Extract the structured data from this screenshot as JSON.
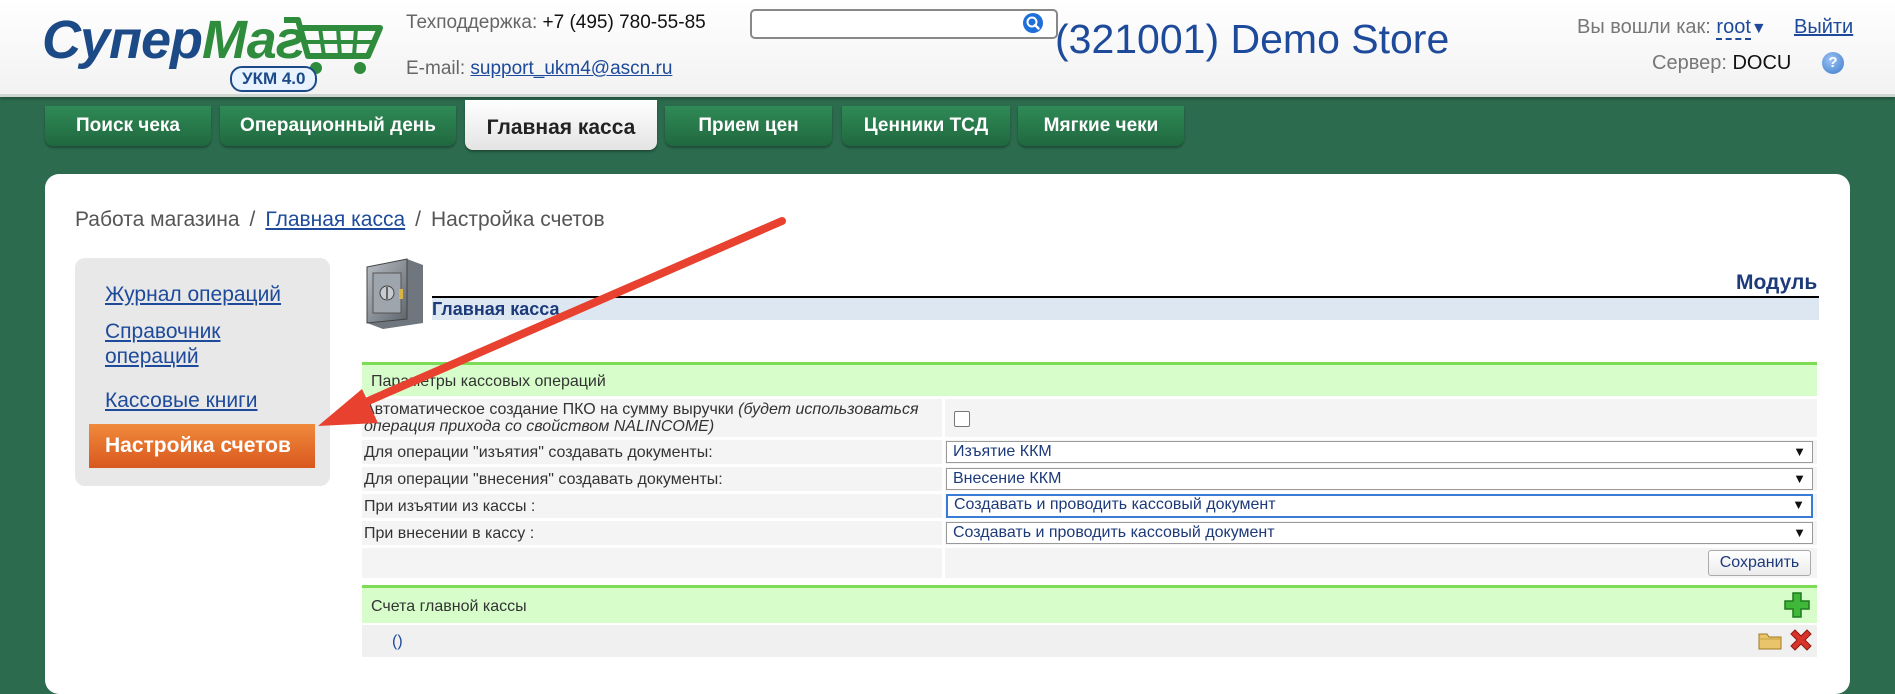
{
  "header": {
    "logo_line1": "Супер",
    "logo_line2": "Маг",
    "logo_badge": "УКМ 4.0",
    "support_label": "Техподдержка:",
    "support_phone": "+7 (495) 780-55-85",
    "email_label": "E-mail:",
    "email_value": "support_ukm4@ascn.ru",
    "search_value": "",
    "store_title": "(321001) Demo Store",
    "logged_in_label": "Вы вошли как:",
    "user": "root",
    "logout": "Выйти",
    "server_label": "Сервер:",
    "server_value": "DOCU",
    "help": "?"
  },
  "tabs": [
    {
      "label": "Поиск чека",
      "active": false
    },
    {
      "label": "Операционный день",
      "active": false
    },
    {
      "label": "Главная касса",
      "active": true
    },
    {
      "label": "Прием цен",
      "active": false
    },
    {
      "label": "Ценники ТСД",
      "active": false
    },
    {
      "label": "Мягкие чеки",
      "active": false
    }
  ],
  "breadcrumb": {
    "root": "Работа магазина",
    "sep": "/",
    "parent": "Главная касса",
    "current": "Настройка счетов"
  },
  "sidebar": {
    "items": [
      {
        "label": "Журнал операций"
      },
      {
        "label": "Справочник"
      },
      {
        "label": "операций"
      },
      {
        "label": "Кассовые книги"
      },
      {
        "label": "Настройка счетов"
      }
    ]
  },
  "module": {
    "label": "Модуль",
    "name": "Главная касса"
  },
  "params": {
    "title": "Параметры кассовых операций",
    "auto_pko_label": "Автоматическое создание ПКО на сумму выручки",
    "auto_pko_note_line1": "(будет использоваться",
    "auto_pko_note_line2": "операция прихода со свойством NALINCOME)",
    "auto_pko_checked": false,
    "withdraw_docs_label": "Для операции \"изъятия\" создавать документы:",
    "withdraw_docs_value": "Изъятие ККМ",
    "deposit_docs_label": "Для операции \"внесения\" создавать документы:",
    "deposit_docs_value": "Внесение ККМ",
    "on_withdraw_label": "При изъятии из кассы :",
    "on_withdraw_value": "Создавать и проводить кассовый документ",
    "on_deposit_label": "При внесении в кассу :",
    "on_deposit_value": "Создавать и проводить кассовый документ",
    "dropdown_arrow": "▼",
    "save": "Сохранить"
  },
  "accounts": {
    "title": "Счета главной кассы",
    "rows": [
      {
        "label": "()"
      }
    ]
  },
  "colors": {
    "brand_green": "#2c6b4e",
    "link_blue": "#1d4a9a",
    "active_orange": "#e06a28",
    "section_green": "#d7fdcb",
    "annotation_red": "#e8412f"
  }
}
